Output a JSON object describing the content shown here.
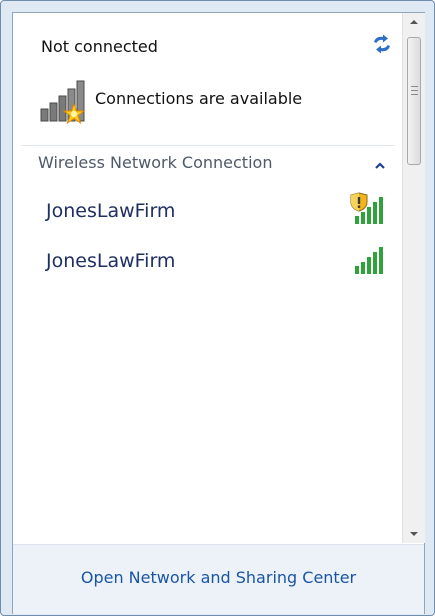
{
  "status": {
    "title": "Not connected",
    "message": "Connections are available",
    "icon": "network-bars-warning-icon",
    "refresh_icon": "refresh-icon"
  },
  "section": {
    "label": "Wireless Network Connection",
    "toggle_icon": "chevron-up-icon"
  },
  "networks": [
    {
      "name": "JonesLawFirm",
      "icon": "secured-wifi-signal-icon",
      "signal_bars": 5,
      "secured": true
    },
    {
      "name": "JonesLawFirm",
      "icon": "wifi-signal-icon",
      "signal_bars": 5,
      "secured": false
    }
  ],
  "footer": {
    "link": "Open Network and Sharing Center"
  },
  "colors": {
    "link": "#1a55a4",
    "network_name": "#1f2f63",
    "signal": "#2fa33a"
  }
}
